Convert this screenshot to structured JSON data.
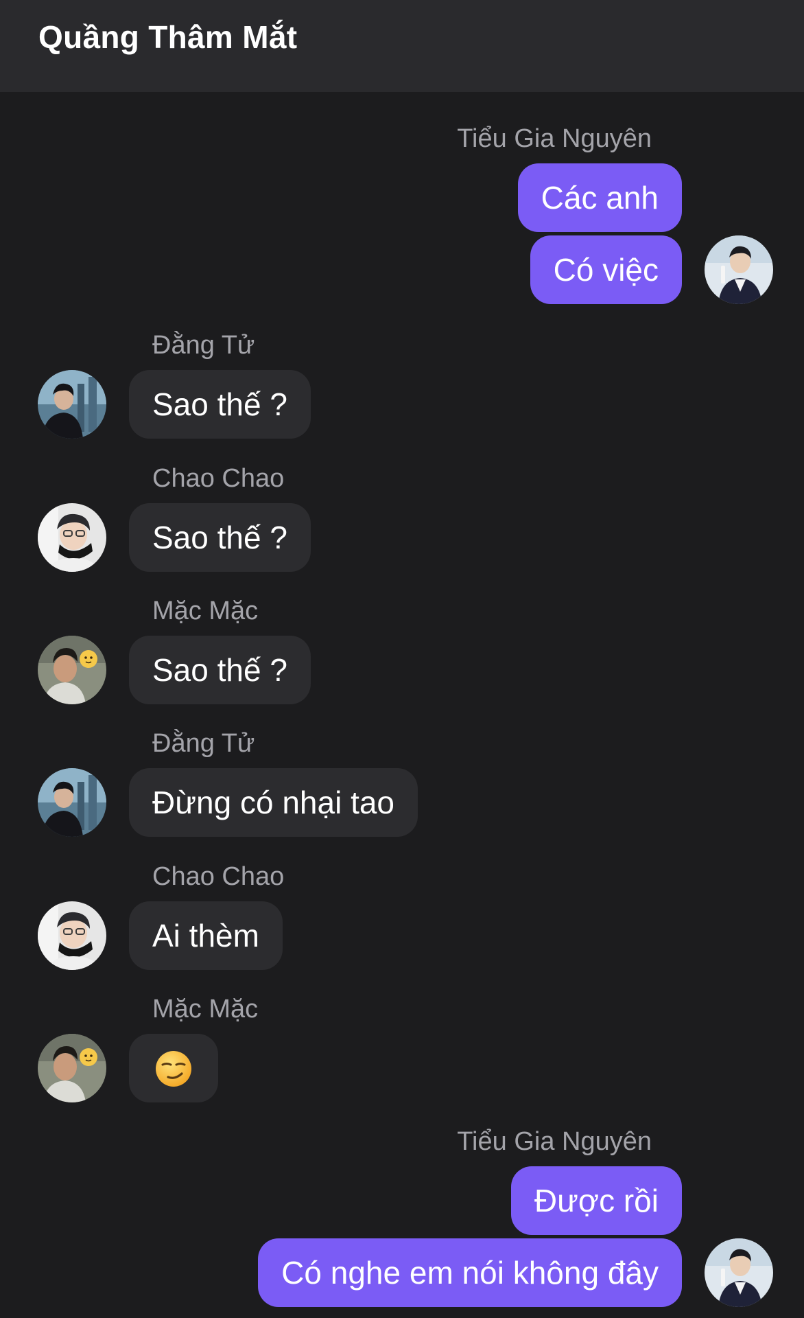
{
  "header": {
    "title": "Quầng Thâm Mắt"
  },
  "messages": [
    {
      "sender": "Tiểu Gia Nguyên",
      "bubbles": [
        "Các anh",
        "Có việc"
      ]
    },
    {
      "sender": "Đằng Tử",
      "text": "Sao thế ?"
    },
    {
      "sender": "Chao Chao",
      "text": "Sao thế ?"
    },
    {
      "sender": "Mặc Mặc",
      "text": "Sao thế ?"
    },
    {
      "sender": "Đằng Tử",
      "text": "Đừng có nhại tao"
    },
    {
      "sender": "Chao Chao",
      "text": "Ai thèm"
    },
    {
      "sender": "Mặc Mặc",
      "emoji": "smirking-face"
    },
    {
      "sender": "Tiểu Gia Nguyên",
      "bubbles": [
        "Được rồi",
        "Có nghe em nói không đây"
      ]
    }
  ],
  "colors": {
    "background": "#1c1c1e",
    "header": "#2a2a2d",
    "my_bubble": "#7b5cf5",
    "their_bubble": "#2c2c2f",
    "sender_label": "#a4a4aa"
  }
}
